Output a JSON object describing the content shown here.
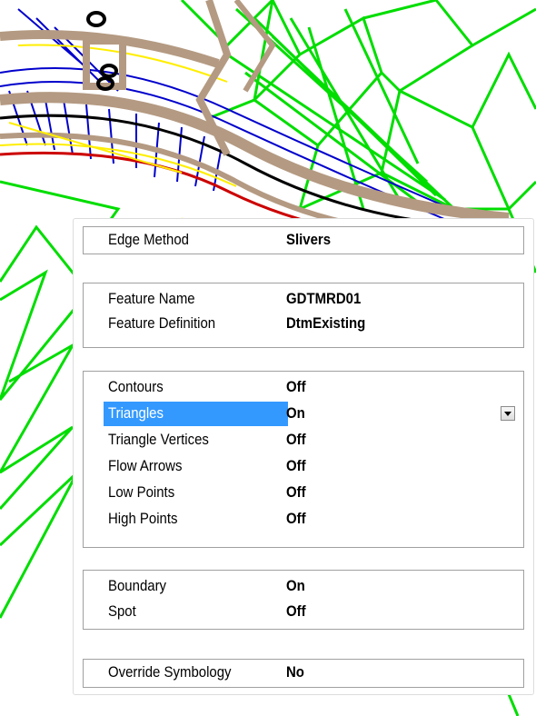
{
  "colors": {
    "selection": "#3399ff",
    "mesh": "#00dd00",
    "contour_blue": "#0000cc",
    "road_tan": "#b49a82",
    "panel_border": "#a0a0a0"
  },
  "edge": {
    "label": "Edge Method",
    "value": "Slivers"
  },
  "feature": {
    "name_label": "Feature Name",
    "name_value": "GDTMRD01",
    "def_label": "Feature Definition",
    "def_value": "DtmExisting"
  },
  "display": {
    "items": [
      {
        "label": "Contours",
        "value": "Off"
      },
      {
        "label": "Triangles",
        "value": "On"
      },
      {
        "label": "Triangle Vertices",
        "value": "Off"
      },
      {
        "label": "Flow Arrows",
        "value": "Off"
      },
      {
        "label": "Low Points",
        "value": "Off"
      },
      {
        "label": "High Points",
        "value": "Off"
      }
    ],
    "dropdown_icon": "chevron-down-icon"
  },
  "extras": {
    "items": [
      {
        "label": "Boundary",
        "value": "On"
      },
      {
        "label": "Spot",
        "value": "Off"
      }
    ]
  },
  "override": {
    "label": "Override Symbology",
    "value": "No"
  }
}
